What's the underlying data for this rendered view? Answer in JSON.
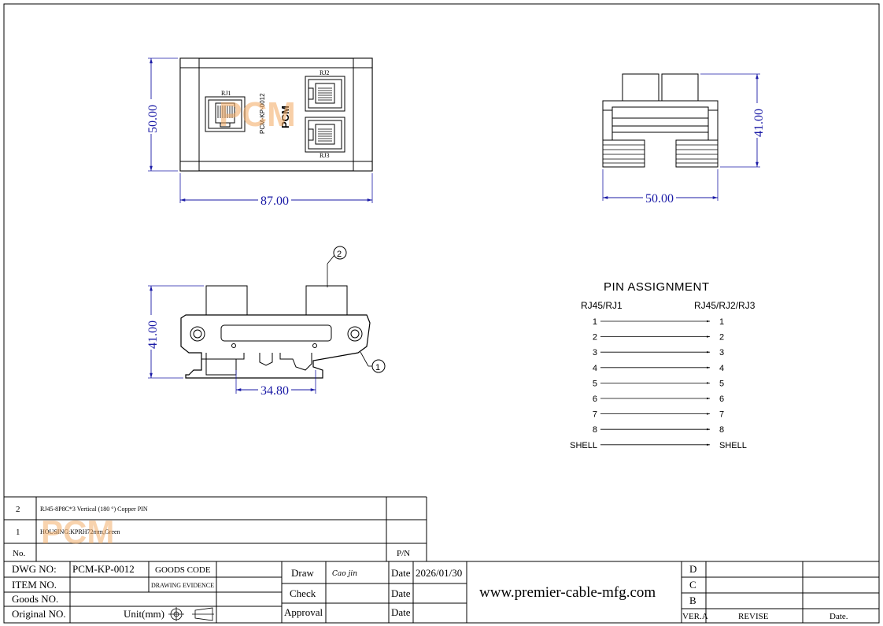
{
  "drawing": {
    "top_view": {
      "width_dim": "87.00",
      "height_dim": "50.00",
      "jack1_label": "RJ1",
      "jack2_label": "RJ2",
      "jack3_label": "RJ3",
      "part_marking": "PCM-KP-0012"
    },
    "side_view": {
      "width_dim": "50.00",
      "height_dim": "41.00"
    },
    "front_view": {
      "height_dim": "41.00",
      "rail_dim": "34.80",
      "callout_1": "1",
      "callout_2": "2"
    },
    "watermark": "PCM"
  },
  "pin_assignment": {
    "title": "PIN   ASSIGNMENT",
    "left_header": "RJ45/RJ1",
    "right_header": "RJ45/RJ2/RJ3",
    "pins": [
      {
        "left": "1",
        "right": "1"
      },
      {
        "left": "2",
        "right": "2"
      },
      {
        "left": "3",
        "right": "3"
      },
      {
        "left": "4",
        "right": "4"
      },
      {
        "left": "5",
        "right": "5"
      },
      {
        "left": "6",
        "right": "6"
      },
      {
        "left": "7",
        "right": "7"
      },
      {
        "left": "8",
        "right": "8"
      },
      {
        "left": "SHELL",
        "right": "SHELL"
      }
    ]
  },
  "bom": {
    "rows": [
      {
        "no": "2",
        "desc": "RJ45-8P8C*3  Vertical (180 °) Copper PIN",
        "pn": ""
      },
      {
        "no": "1",
        "desc": "HOUSING:KPRH72mm,Green",
        "pn": ""
      }
    ],
    "header_no": "No.",
    "header_pn": "P/N"
  },
  "title_block": {
    "dwg_no_label": "DWG NO:",
    "dwg_no_value": "PCM-KP-0012",
    "goods_code_label": "GOODS CODE",
    "drawing_evidence_label": "DRAWING EVIDENCE",
    "item_no_label": "ITEM NO.",
    "goods_no_label": "Goods NO.",
    "original_no_label": "Original NO.",
    "unit_label": "Unit(mm)",
    "draw_label": "Draw",
    "drawer_sig": "Cao jin",
    "check_label": "Check",
    "approval_label": "Approval",
    "date_label": "Date",
    "date_value": "2026/01/30",
    "website": "www.premier-cable-mfg.com",
    "rev_d": "D",
    "rev_c": "C",
    "rev_b": "B",
    "ver_label": "VER.A",
    "revise_label": "REVISE",
    "date_col_label": "Date."
  }
}
